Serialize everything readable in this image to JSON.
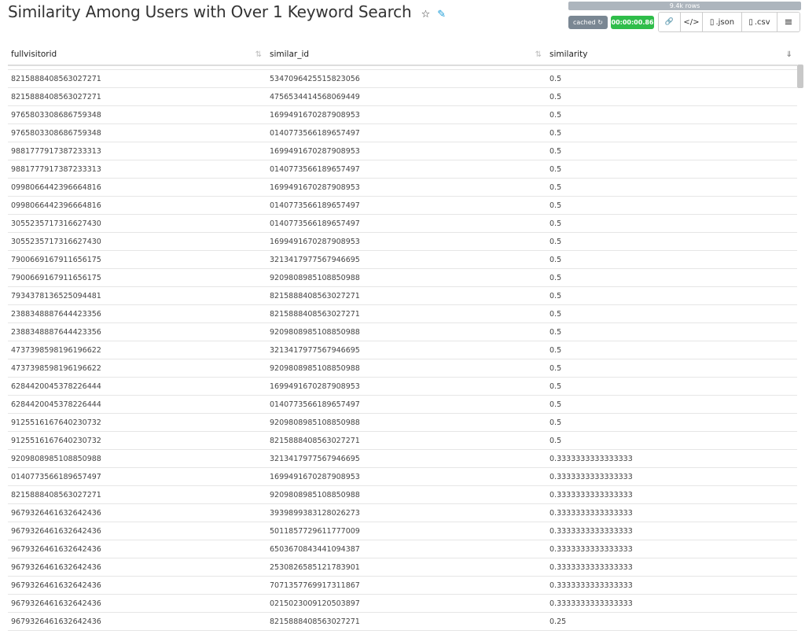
{
  "header": {
    "title": "Similarity Among Users with Over 1 Keyword Search",
    "star_glyph": "☆",
    "edit_glyph": "✎"
  },
  "status": {
    "rows": "9.4k rows",
    "cached": "cached ↻",
    "time": "00:00:00.86"
  },
  "toolbar": {
    "link_glyph": "🔗",
    "code_glyph": "</>",
    "json_label": ".json",
    "csv_label": ".csv",
    "menu_glyph": "≡"
  },
  "table": {
    "columns": [
      {
        "label": "fullvisitorid",
        "sort": "⇅"
      },
      {
        "label": "similar_id",
        "sort": "⇅"
      },
      {
        "label": "similarity",
        "sort": "⇓"
      }
    ],
    "rows": [
      [
        "8215888408563027271",
        "5347096425515823056",
        "0.5"
      ],
      [
        "8215888408563027271",
        "4756534414568069449",
        "0.5"
      ],
      [
        "9765803308686759348",
        "1699491670287908953",
        "0.5"
      ],
      [
        "9765803308686759348",
        "0140773566189657497",
        "0.5"
      ],
      [
        "9881777917387233313",
        "1699491670287908953",
        "0.5"
      ],
      [
        "9881777917387233313",
        "0140773566189657497",
        "0.5"
      ],
      [
        "0998066442396664816",
        "1699491670287908953",
        "0.5"
      ],
      [
        "0998066442396664816",
        "0140773566189657497",
        "0.5"
      ],
      [
        "3055235717316627430",
        "0140773566189657497",
        "0.5"
      ],
      [
        "3055235717316627430",
        "1699491670287908953",
        "0.5"
      ],
      [
        "7900669167911656175",
        "3213417977567946695",
        "0.5"
      ],
      [
        "7900669167911656175",
        "9209808985108850988",
        "0.5"
      ],
      [
        "7934378136525094481",
        "8215888408563027271",
        "0.5"
      ],
      [
        "2388348887644423356",
        "8215888408563027271",
        "0.5"
      ],
      [
        "2388348887644423356",
        "9209808985108850988",
        "0.5"
      ],
      [
        "4737398598196196622",
        "3213417977567946695",
        "0.5"
      ],
      [
        "4737398598196196622",
        "9209808985108850988",
        "0.5"
      ],
      [
        "6284420045378226444",
        "1699491670287908953",
        "0.5"
      ],
      [
        "6284420045378226444",
        "0140773566189657497",
        "0.5"
      ],
      [
        "9125516167640230732",
        "9209808985108850988",
        "0.5"
      ],
      [
        "9125516167640230732",
        "8215888408563027271",
        "0.5"
      ],
      [
        "9209808985108850988",
        "3213417977567946695",
        "0.3333333333333333"
      ],
      [
        "0140773566189657497",
        "1699491670287908953",
        "0.3333333333333333"
      ],
      [
        "8215888408563027271",
        "9209808985108850988",
        "0.3333333333333333"
      ],
      [
        "9679326461632642436",
        "3939899383128026273",
        "0.3333333333333333"
      ],
      [
        "9679326461632642436",
        "5011857729611777009",
        "0.3333333333333333"
      ],
      [
        "9679326461632642436",
        "6503670843441094387",
        "0.3333333333333333"
      ],
      [
        "9679326461632642436",
        "2530826585121783901",
        "0.3333333333333333"
      ],
      [
        "9679326461632642436",
        "7071357769917311867",
        "0.3333333333333333"
      ],
      [
        "9679326461632642436",
        "0215023009120503897",
        "0.3333333333333333"
      ],
      [
        "9679326461632642436",
        "8215888408563027271",
        "0.25"
      ]
    ]
  }
}
